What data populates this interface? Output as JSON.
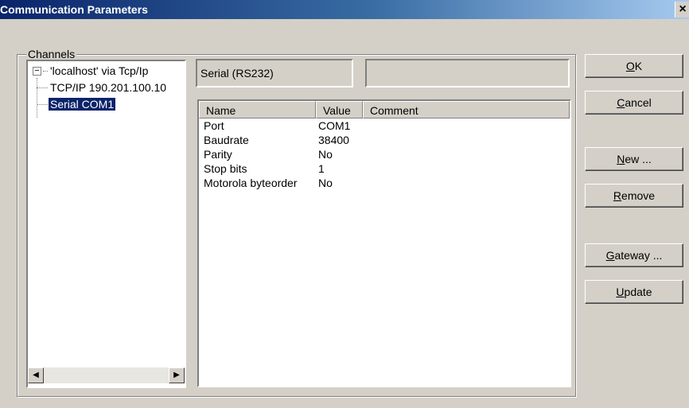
{
  "window": {
    "title": "Communication Parameters",
    "close_label": "×"
  },
  "channels": {
    "group_label": "Channels",
    "tree": {
      "root_label": "'localhost' via Tcp/Ip",
      "expander": "−",
      "children": [
        "TCP/IP 190.201.100.10",
        "Serial COM1"
      ],
      "selected": "Serial COM1"
    },
    "scroll_left": "◀",
    "scroll_right": "▶"
  },
  "channel_name": "Serial (RS232)",
  "channel_info": "",
  "parameters": {
    "columns": [
      "Name",
      "Value",
      "Comment"
    ],
    "rows": [
      {
        "name": "Port",
        "value": "COM1",
        "comment": ""
      },
      {
        "name": "Baudrate",
        "value": "38400",
        "comment": ""
      },
      {
        "name": "Parity",
        "value": "No",
        "comment": ""
      },
      {
        "name": "Stop bits",
        "value": "1",
        "comment": ""
      },
      {
        "name": "Motorola byteorder",
        "value": "No",
        "comment": ""
      }
    ]
  },
  "buttons": {
    "ok": {
      "mnemonic": "O",
      "rest": "K"
    },
    "cancel": {
      "mnemonic": "C",
      "rest": "ancel"
    },
    "new": {
      "mnemonic": "N",
      "rest": "ew ..."
    },
    "remove": {
      "mnemonic": "R",
      "rest": "emove"
    },
    "gateway": {
      "mnemonic": "G",
      "rest": "ateway ..."
    },
    "update": {
      "mnemonic": "U",
      "rest": "pdate"
    }
  }
}
